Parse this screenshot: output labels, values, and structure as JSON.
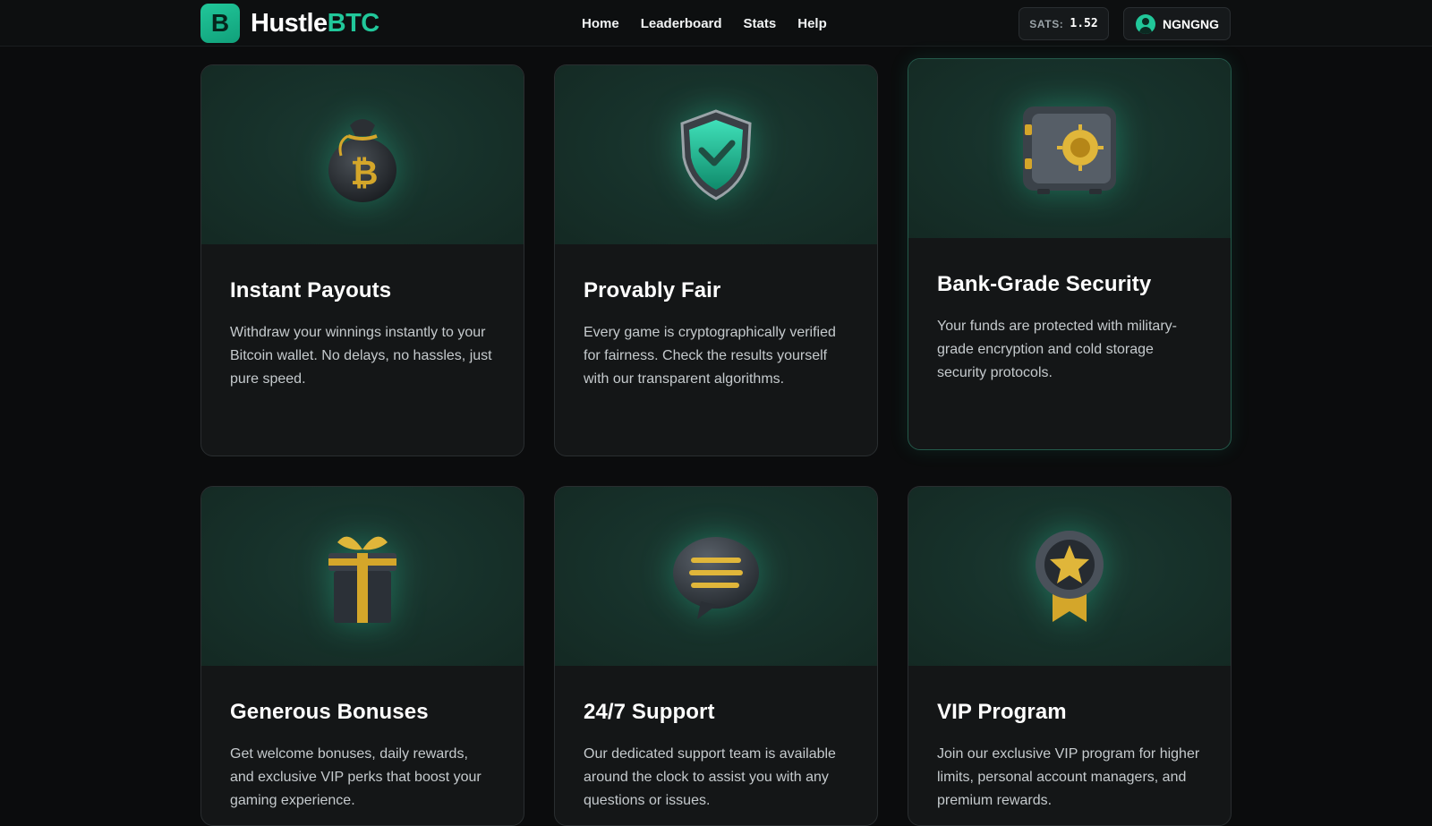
{
  "brand": {
    "mark": "B",
    "name_main": "Hustle",
    "name_accent": "BTC"
  },
  "nav": {
    "items": [
      {
        "label": "Home"
      },
      {
        "label": "Leaderboard"
      },
      {
        "label": "Stats"
      },
      {
        "label": "Help"
      }
    ]
  },
  "balance": {
    "label": "SATS:",
    "value": "1.52"
  },
  "user": {
    "name": "NGNGNG"
  },
  "features": [
    {
      "title": "Instant Payouts",
      "text": "Withdraw your winnings instantly to your Bitcoin wallet. No delays, no hassles, just pure speed.",
      "icon": "bitcoin-bag-icon"
    },
    {
      "title": "Provably Fair",
      "text": "Every game is cryptographically verified for fairness. Check the results yourself with our transparent algorithms.",
      "icon": "shield-check-icon"
    },
    {
      "title": "Bank-Grade Security",
      "text": "Your funds are protected with military-grade encryption and cold storage security protocols.",
      "icon": "vault-icon"
    },
    {
      "title": "Generous Bonuses",
      "text": "Get welcome bonuses, daily rewards, and exclusive VIP perks that boost your gaming experience.",
      "icon": "gift-icon"
    },
    {
      "title": "24/7 Support",
      "text": "Our dedicated support team is available around the clock to assist you with any questions or issues.",
      "icon": "chat-bubble-icon"
    },
    {
      "title": "VIP Program",
      "text": "Join our exclusive VIP program for higher limits, personal account managers, and premium rewards.",
      "icon": "star-medal-icon"
    }
  ],
  "colors": {
    "accent": "#21c79a",
    "gold": "#d4a62a",
    "background": "#0b0c0d",
    "card": "#141617"
  }
}
